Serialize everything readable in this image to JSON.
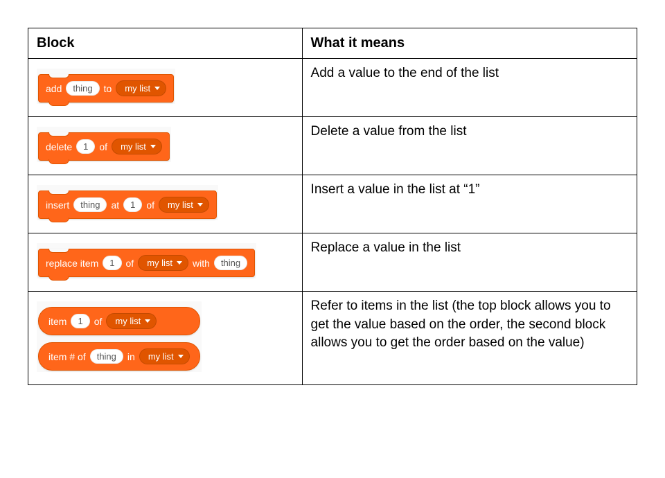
{
  "headers": {
    "block": "Block",
    "meaning": "What it means"
  },
  "rows": [
    {
      "desc": "Add a value to the end of the list",
      "block": {
        "type": "stack",
        "parts": [
          {
            "t": "label",
            "v": "add"
          },
          {
            "t": "pill",
            "v": "thing"
          },
          {
            "t": "label",
            "v": "to"
          },
          {
            "t": "menu",
            "v": "my list"
          }
        ]
      }
    },
    {
      "desc": "Delete a value from the list",
      "block": {
        "type": "stack",
        "parts": [
          {
            "t": "label",
            "v": "delete"
          },
          {
            "t": "pill",
            "v": "1"
          },
          {
            "t": "label",
            "v": "of"
          },
          {
            "t": "menu",
            "v": "my list"
          }
        ]
      }
    },
    {
      "desc": "Insert a value in the list at “1”",
      "block": {
        "type": "stack",
        "parts": [
          {
            "t": "label",
            "v": "insert"
          },
          {
            "t": "pill",
            "v": "thing"
          },
          {
            "t": "label",
            "v": "at"
          },
          {
            "t": "pill",
            "v": "1"
          },
          {
            "t": "label",
            "v": "of"
          },
          {
            "t": "menu",
            "v": "my list"
          }
        ]
      }
    },
    {
      "desc": "Replace a value in the list",
      "block": {
        "type": "stack",
        "parts": [
          {
            "t": "label",
            "v": "replace item"
          },
          {
            "t": "pill",
            "v": "1"
          },
          {
            "t": "label",
            "v": "of"
          },
          {
            "t": "menu",
            "v": "my list"
          },
          {
            "t": "label",
            "v": "with"
          },
          {
            "t": "pill",
            "v": "thing"
          }
        ]
      }
    },
    {
      "desc": "Refer to items in the list (the top block allows you to get the value based on the order, the second block allows you to get the order based on the value)",
      "blocks": [
        {
          "type": "reporter",
          "parts": [
            {
              "t": "label",
              "v": "item"
            },
            {
              "t": "pill",
              "v": "1"
            },
            {
              "t": "label",
              "v": "of"
            },
            {
              "t": "menu",
              "v": "my list"
            }
          ]
        },
        {
          "type": "reporter",
          "parts": [
            {
              "t": "label",
              "v": "item # of"
            },
            {
              "t": "pill",
              "v": "thing"
            },
            {
              "t": "label",
              "v": "in"
            },
            {
              "t": "menu",
              "v": "my list"
            }
          ]
        }
      ]
    }
  ]
}
